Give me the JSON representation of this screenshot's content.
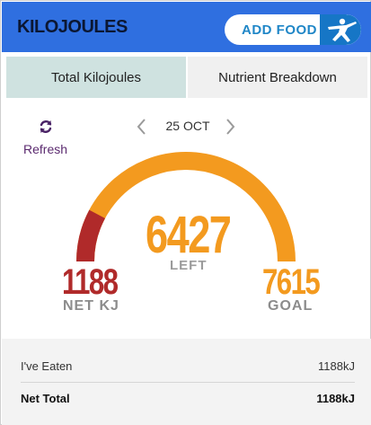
{
  "header": {
    "title": "KILOJOULES",
    "add_food_label": "ADD FOOD",
    "logo_icon": "myfitnesspal-figure-icon"
  },
  "tabs": [
    {
      "label": "Total Kilojoules",
      "active": true
    },
    {
      "label": "Nutrient Breakdown",
      "active": false
    }
  ],
  "refresh": {
    "label": "Refresh",
    "icon": "refresh-icon"
  },
  "date_nav": {
    "date": "25 OCT",
    "prev_icon": "chevron-left-icon",
    "next_icon": "chevron-right-icon"
  },
  "gauge": {
    "left_value": "6427",
    "left_label": "LEFT",
    "net_value": "1188",
    "net_label": "NET KJ",
    "goal_value": "7615",
    "goal_label": "GOAL",
    "consumed_fraction": 0.156,
    "colors": {
      "remaining": "#f39a1f",
      "consumed": "#b02a2a"
    }
  },
  "summary": {
    "rows": [
      {
        "label": "I've Eaten",
        "value": "1188kJ"
      },
      {
        "label": "Net Total",
        "value": "1188kJ"
      }
    ]
  },
  "colors": {
    "header_bg": "#2f6fe0",
    "active_tab": "#cfe2e0",
    "refresh_text": "#5b2a6f"
  }
}
